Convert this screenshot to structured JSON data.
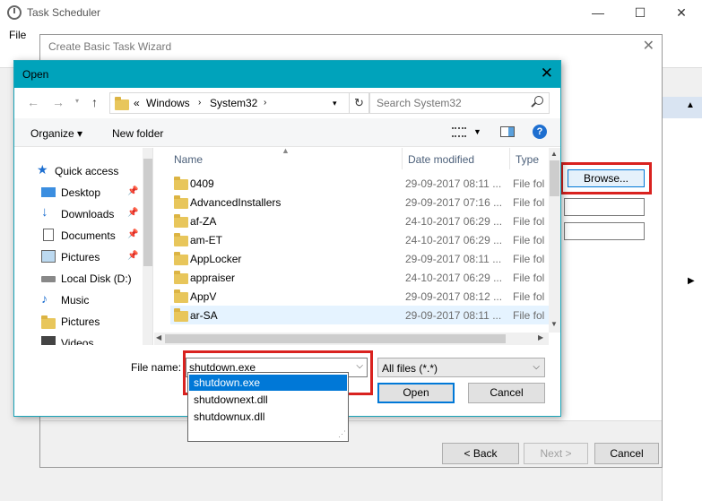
{
  "task_scheduler": {
    "title": "Task Scheduler",
    "menu_file": "File",
    "minimize": "—",
    "maximize": "☐",
    "close": "✕"
  },
  "wizard": {
    "title": "Create Basic Task Wizard",
    "close": "✕",
    "browse_label": "Browse...",
    "back_label": "< Back",
    "next_label": "Next >",
    "cancel_label": "Cancel"
  },
  "open_dialog": {
    "title": "Open",
    "close": "✕",
    "breadcrumb": {
      "prefix": "«",
      "items": [
        "Windows",
        "System32"
      ]
    },
    "search_placeholder": "Search System32",
    "toolbar": {
      "organize": "Organize ▾",
      "new_folder": "New folder"
    },
    "nav_items": [
      {
        "label": "Quick access",
        "icon": "star-icon",
        "pinned": false
      },
      {
        "label": "Desktop",
        "icon": "desktop-icon",
        "pinned": true
      },
      {
        "label": "Downloads",
        "icon": "download-icon",
        "pinned": true
      },
      {
        "label": "Documents",
        "icon": "documents-icon",
        "pinned": true
      },
      {
        "label": "Pictures",
        "icon": "pictures-icon",
        "pinned": true
      },
      {
        "label": "Local Disk (D:)",
        "icon": "drive-icon",
        "pinned": false
      },
      {
        "label": "Music",
        "icon": "music-icon",
        "pinned": false
      },
      {
        "label": "Pictures",
        "icon": "folder-icon",
        "pinned": false
      },
      {
        "label": "Videos",
        "icon": "videos-icon",
        "pinned": false
      }
    ],
    "columns": [
      "Name",
      "Date modified",
      "Type"
    ],
    "files": [
      {
        "name": "0409",
        "date": "29-09-2017 08:11 ...",
        "type": "File fol"
      },
      {
        "name": "AdvancedInstallers",
        "date": "29-09-2017 07:16 ...",
        "type": "File fol"
      },
      {
        "name": "af-ZA",
        "date": "24-10-2017 06:29 ...",
        "type": "File fol"
      },
      {
        "name": "am-ET",
        "date": "24-10-2017 06:29 ...",
        "type": "File fol"
      },
      {
        "name": "AppLocker",
        "date": "29-09-2017 08:11 ...",
        "type": "File fol"
      },
      {
        "name": "appraiser",
        "date": "24-10-2017 06:29 ...",
        "type": "File fol"
      },
      {
        "name": "AppV",
        "date": "29-09-2017 08:12 ...",
        "type": "File fol"
      },
      {
        "name": "ar-SA",
        "date": "29-09-2017 08:11 ...",
        "type": "File fol"
      }
    ],
    "filename_label": "File name:",
    "filename_value": "shutdown.exe",
    "filter_value": "All files (*.*)",
    "open_label": "Open",
    "cancel_label": "Cancel",
    "autocomplete": [
      "shutdown.exe",
      "shutdownext.dll",
      "shutdownux.dll"
    ]
  }
}
